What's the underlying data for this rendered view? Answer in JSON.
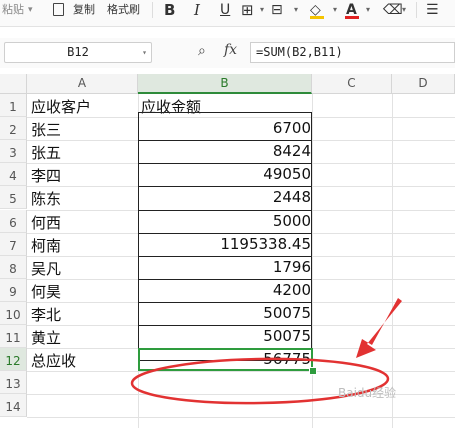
{
  "toolbar": {
    "paste_label": "粘贴",
    "copy_label": "复制",
    "format_painter_label": "格式刷",
    "bold": "B",
    "italic": "I",
    "underline": "U",
    "font_color_letter": "A"
  },
  "formula_bar": {
    "cell_ref": "B12",
    "fx_label": "fx",
    "formula": "=SUM(B2,B11)"
  },
  "columns": [
    "A",
    "B",
    "C",
    "D"
  ],
  "rows": [
    {
      "num": "1",
      "a": "应收客户",
      "b": ""
    },
    {
      "num": "2",
      "a": "张三",
      "b": "6700"
    },
    {
      "num": "3",
      "a": "张五",
      "b": "8424"
    },
    {
      "num": "4",
      "a": "李四",
      "b": "49050"
    },
    {
      "num": "5",
      "a": "陈东",
      "b": "2448"
    },
    {
      "num": "6",
      "a": "何西",
      "b": "5000"
    },
    {
      "num": "7",
      "a": "柯南",
      "b": "1195338.45"
    },
    {
      "num": "8",
      "a": "吴凡",
      "b": "1796"
    },
    {
      "num": "9",
      "a": "何昊",
      "b": "4200"
    },
    {
      "num": "10",
      "a": "李北",
      "b": "50075"
    },
    {
      "num": "11",
      "a": "黄立",
      "b": "50075"
    },
    {
      "num": "12",
      "a": "总应收",
      "b": "56775"
    },
    {
      "num": "13",
      "a": "",
      "b": ""
    },
    {
      "num": "14",
      "a": "",
      "b": ""
    }
  ],
  "b_header": "应收金额",
  "watermark": "Baidu经验",
  "colors": {
    "selection": "#2e9c3e",
    "annotation": "#e23232"
  }
}
